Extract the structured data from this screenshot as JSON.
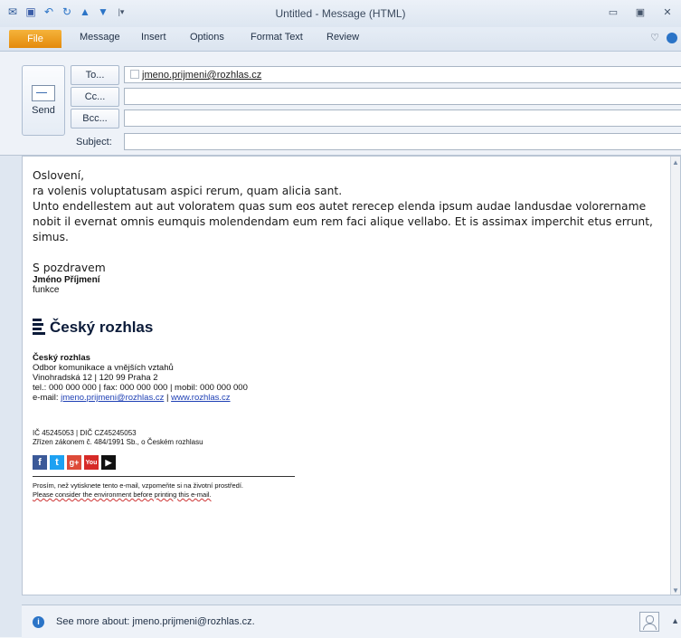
{
  "window": {
    "title": "Untitled - Message (HTML)"
  },
  "quick_access": {
    "icons": [
      "outlook-icon",
      "save-icon",
      "undo-icon",
      "redo-icon",
      "up-icon",
      "down-icon",
      "customize-icon"
    ]
  },
  "ribbon": {
    "file_tab": "File",
    "tabs": [
      "Message",
      "Insert",
      "Options",
      "Format Text",
      "Review"
    ]
  },
  "compose": {
    "send_label": "Send",
    "to_label": "To...",
    "cc_label": "Cc...",
    "bcc_label": "Bcc...",
    "subject_label": "Subject:",
    "to_value": "jmeno.prijmeni@rozhlas.cz",
    "cc_value": "",
    "bcc_value": "",
    "subject_value": ""
  },
  "body": {
    "greeting": "Oslovení,",
    "line1": "ra volenis voluptatusam aspici rerum, quam alicia sant.",
    "line2": "Unto endellestem aut aut voloratem quas sum eos autet rerecep elenda ipsum audae landusdae volorername nobit il evernat omnis eumquis molendendam eum rem faci alique vellabo. Et is assimax imperchit etus errunt, simus.",
    "closing": "S pozdravem"
  },
  "signature": {
    "name": "Jméno Příjmení",
    "role": "funkce",
    "logo_text": "Český rozhlas",
    "org": "Český rozhlas",
    "dept": "Odbor komunikace a vnějších vztahů",
    "address": "Vinohradská 12 | 120 99 Praha 2",
    "phones": "tel.: 000 000 000 | fax: 000 000 000 | mobil: 000 000 000",
    "email_prefix": "e-mail: ",
    "email": "jmeno.prijmeni@rozhlas.cz",
    "sep": " | ",
    "web": "www.rozhlas.cz",
    "ico": "IČ 45245053 | DIČ CZ45245053",
    "law": "Zřízen zákonem č. 484/1991 Sb., o Českém rozhlasu",
    "social": [
      {
        "label": "f",
        "icon": "facebook-icon",
        "color": "#3b5998"
      },
      {
        "label": "t",
        "icon": "twitter-icon",
        "color": "#1da1f2"
      },
      {
        "label": "g+",
        "icon": "google-plus-icon",
        "color": "#dd4b39"
      },
      {
        "label": "You",
        "icon": "youtube-icon",
        "color": "#d62a27"
      },
      {
        "label": "▶",
        "icon": "play-icon",
        "color": "#111111"
      }
    ],
    "env_cz": "Prosím, než vytisknete tento e-mail, vzpomeňte si na životní prostředí.",
    "env_en": "Please consider the environment before printing this e-mail."
  },
  "status_bar": {
    "text": "See more about: jmeno.prijmeni@rozhlas.cz."
  }
}
